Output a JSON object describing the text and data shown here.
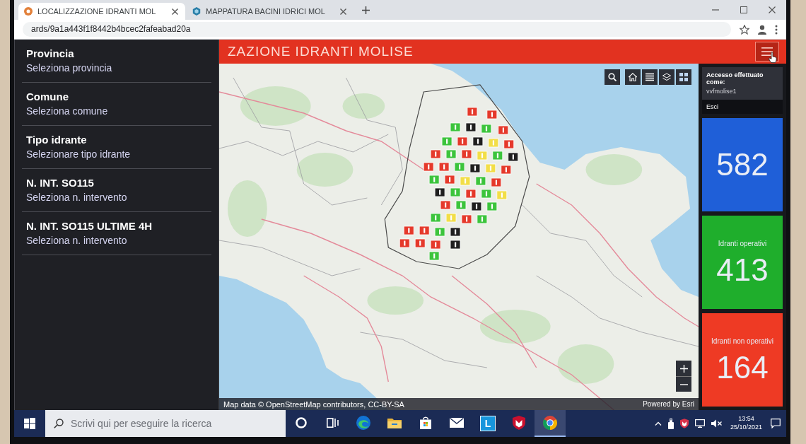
{
  "browser": {
    "tabs": [
      {
        "title": "LOCALIZZAZIONE IDRANTI MOL",
        "selected": true
      },
      {
        "title": "MAPPATURA BACINI IDRICI MOL",
        "selected": false
      }
    ],
    "address_bar": {
      "url": "ards/9a1a443f1f8442b4bcec2fafeabad20a"
    }
  },
  "header": {
    "title": "ZAZIONE IDRANTI MOLISE"
  },
  "sidebar": {
    "filters": [
      {
        "label": "Provincia",
        "placeholder": "Seleziona provincia"
      },
      {
        "label": "Comune",
        "placeholder": "Seleziona comune"
      },
      {
        "label": "Tipo idrante",
        "placeholder": "Selezionare tipo idrante"
      },
      {
        "label": "N. INT. SO115",
        "placeholder": "Seleziona n. intervento"
      },
      {
        "label": "N. INT. SO115 ULTIME 4H",
        "placeholder": "Seleziona n. intervento"
      }
    ]
  },
  "map": {
    "attribution": "Map data © OpenStreetMap contributors, CC-BY-SA",
    "credit": "Powered by Esri"
  },
  "user_menu": {
    "open": true,
    "caption": "Accesso effettuato come:",
    "username": "vvfmolise1",
    "logout": "Esci"
  },
  "stats": [
    {
      "value": "582",
      "color": "#1f5fd8"
    },
    {
      "label": "Idranti operativi",
      "value": "413",
      "color": "#1fae2c"
    },
    {
      "label": "Idranti non operativi",
      "value": "164",
      "color": "#ee3a24"
    }
  ],
  "taskbar": {
    "search": {
      "placeholder": "Scrivi qui per eseguire la ricerca"
    },
    "apps": [
      {
        "kind": "assistant",
        "selected": false
      },
      {
        "kind": "task-view",
        "selected": false
      },
      {
        "kind": "edge",
        "selected": false
      },
      {
        "kind": "explorer",
        "selected": false
      },
      {
        "kind": "store",
        "selected": false
      },
      {
        "kind": "mail",
        "selected": false
      },
      {
        "kind": "launcher",
        "letter": "L",
        "selected": false
      },
      {
        "kind": "antivirus",
        "selected": false
      },
      {
        "kind": "chrome",
        "selected": true
      }
    ],
    "clock": {
      "time": "13:54",
      "date": "25/10/2021"
    }
  }
}
